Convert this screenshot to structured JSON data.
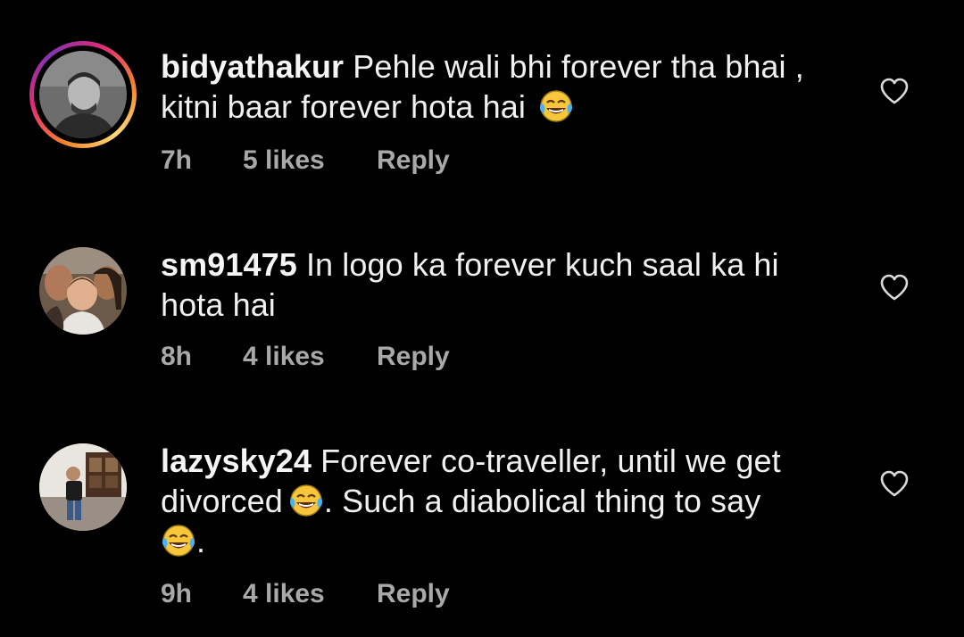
{
  "comments": [
    {
      "username": "bidyathakur",
      "text_line1": "Pehle wali bhi forever tha bhai ,",
      "text_line2": "kitni baar forever hota hai",
      "emoji_icon": "face-with-tears-of-joy-icon",
      "time": "7h",
      "likes": "5 likes",
      "reply": "Reply",
      "has_story_ring": true
    },
    {
      "username": "sm91475",
      "text_line1": "In logo ka forever kuch saal ka hi",
      "text_line2": "hota hai",
      "time": "8h",
      "likes": "4 likes",
      "reply": "Reply",
      "has_story_ring": false
    },
    {
      "username": "lazysky24",
      "text_line1": "Forever co-traveller, until we get",
      "text_line2_a": "divorced",
      "text_line2_b": ". Such a diabolical thing to say",
      "text_line3": ".",
      "emoji_icon": "face-with-tears-of-joy-icon",
      "time": "9h",
      "likes": "4 likes",
      "reply": "Reply",
      "has_story_ring": false
    }
  ],
  "colors": {
    "background": "#000000",
    "text": "#f0f0f0",
    "meta": "#a8a8a8",
    "heart_outline": "#d9d9d9"
  },
  "icons": {
    "like": "heart-outline-icon"
  }
}
